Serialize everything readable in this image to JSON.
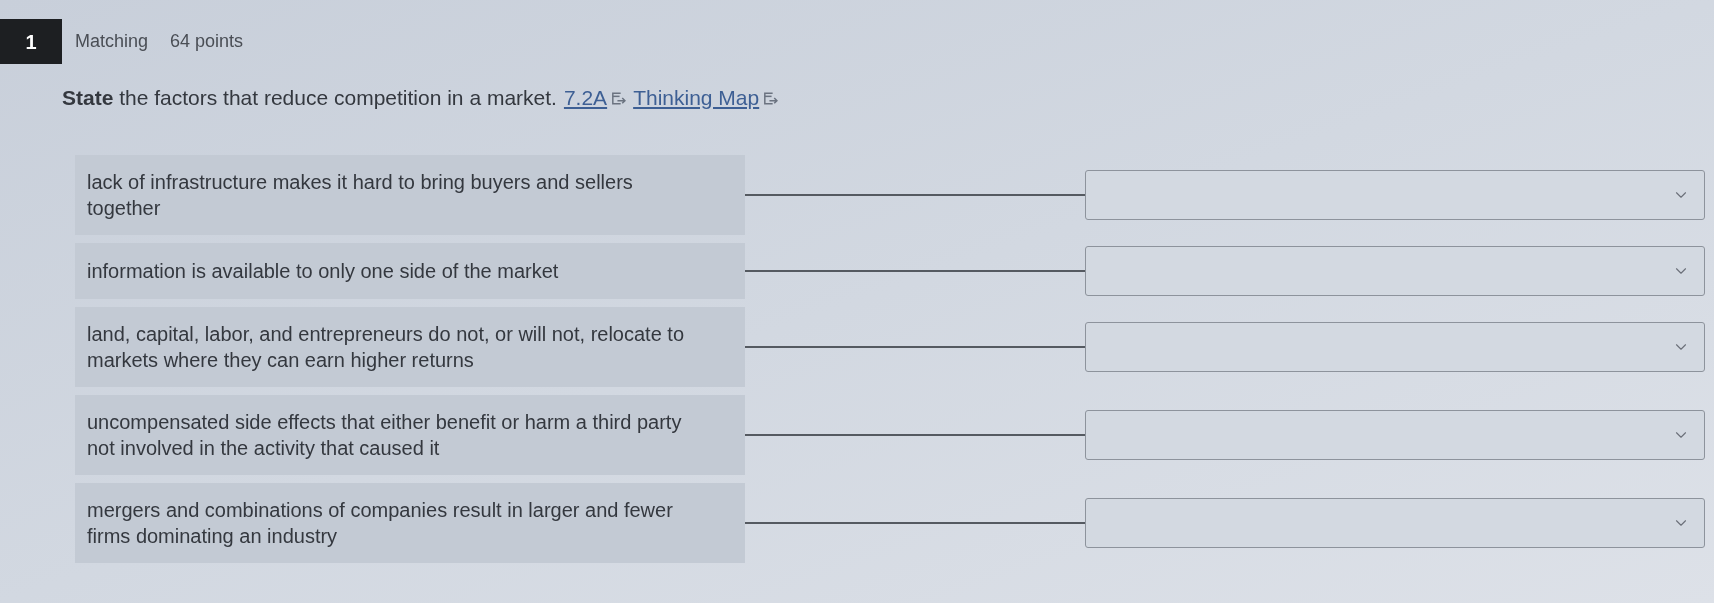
{
  "question": {
    "number": "1",
    "type": "Matching",
    "points": "64 points",
    "prompt": "**State** the factors that reduce competition in a market.",
    "links": [
      {
        "text": "7.2A"
      },
      {
        "text": "Thinking Map"
      }
    ]
  },
  "pairs": [
    {
      "prompt": "lack of infrastructure makes it hard to bring buyers and sellers together"
    },
    {
      "prompt": "information is available to only one side of the market"
    },
    {
      "prompt": "land, capital, labor, and entrepreneurs do not, or will not, relocate to markets where they can earn higher returns"
    },
    {
      "prompt": "uncompensated side effects that either beneﬁt or harm a third party not involved in the activity that caused it"
    },
    {
      "prompt": "mergers and combinations of companies result in larger and fewer ﬁrms dominating an industry"
    }
  ]
}
